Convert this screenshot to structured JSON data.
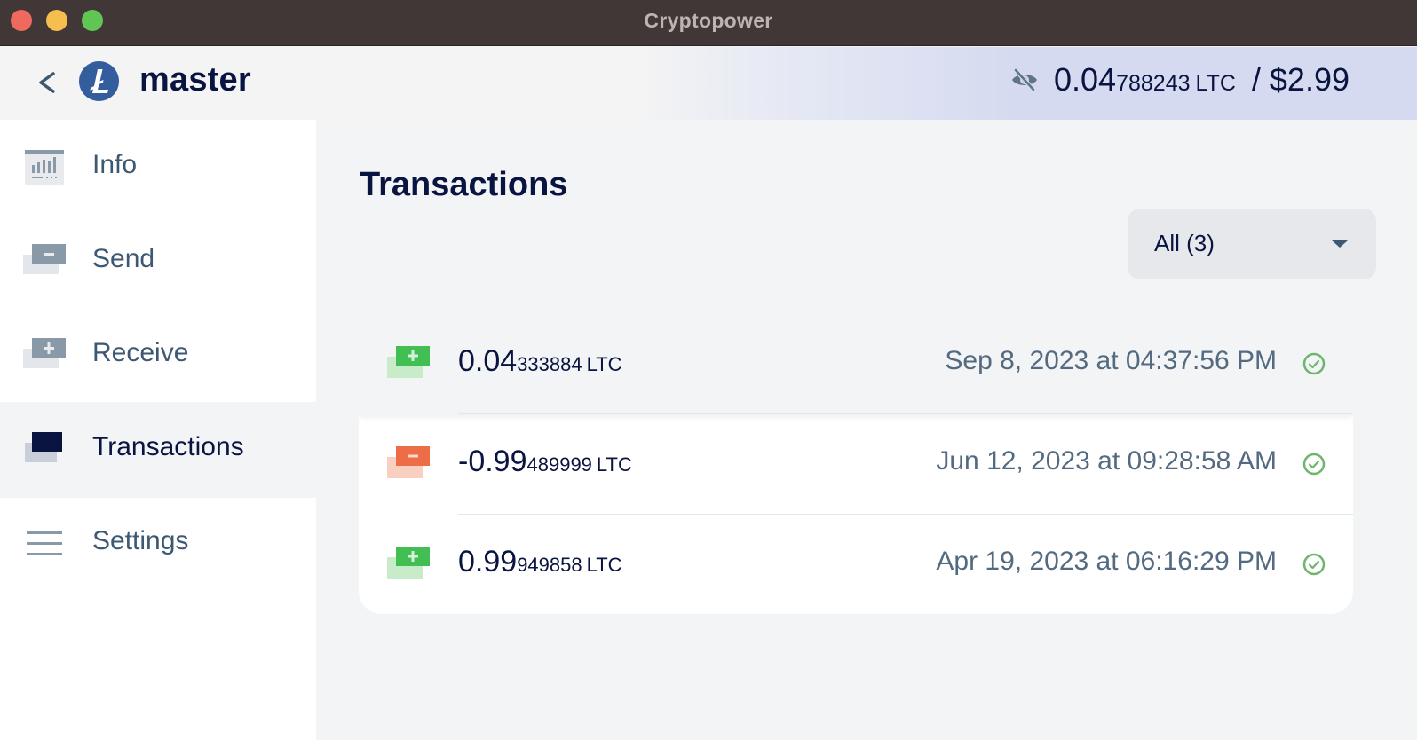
{
  "window": {
    "title": "Cryptopower",
    "controls": [
      "close",
      "minimize",
      "maximize"
    ]
  },
  "header": {
    "back_icon": "chevron-left-icon",
    "coin_icon": "litecoin-icon",
    "wallet_name": "master",
    "visibility_icon": "eye-off-icon",
    "balance_main": "0.04",
    "balance_sub": "788243",
    "balance_unit": "LTC",
    "balance_usd": "/ $2.99"
  },
  "sidebar": {
    "items": [
      {
        "label": "Info",
        "icon": "info-chart-icon",
        "active": false
      },
      {
        "label": "Send",
        "icon": "send-icon",
        "active": false
      },
      {
        "label": "Receive",
        "icon": "receive-icon",
        "active": false
      },
      {
        "label": "Transactions",
        "icon": "transactions-icon",
        "active": true
      },
      {
        "label": "Settings",
        "icon": "menu-icon",
        "active": false
      }
    ]
  },
  "main": {
    "title": "Transactions",
    "filter": {
      "selected": "All (3)"
    },
    "transactions": [
      {
        "type": "received",
        "amount_main": "0.04",
        "amount_sub": "333884",
        "unit": "LTC",
        "date": "Sep 8, 2023 at 04:37:56 PM",
        "status": "confirmed"
      },
      {
        "type": "sent",
        "amount_main": "-0.99",
        "amount_sub": "489999",
        "unit": "LTC",
        "date": "Jun 12, 2023 at 09:28:58 AM",
        "status": "confirmed"
      },
      {
        "type": "received",
        "amount_main": "0.99",
        "amount_sub": "949858",
        "unit": "LTC",
        "date": "Apr 19, 2023 at 06:16:29 PM",
        "status": "confirmed"
      }
    ]
  },
  "colors": {
    "titlebar": "#403736",
    "text_primary": "#091440",
    "text_secondary": "#3d5873",
    "received": "#41bf53",
    "sent": "#ed6d47",
    "confirmed": "#6fb56b",
    "coin": "#345d9d"
  }
}
